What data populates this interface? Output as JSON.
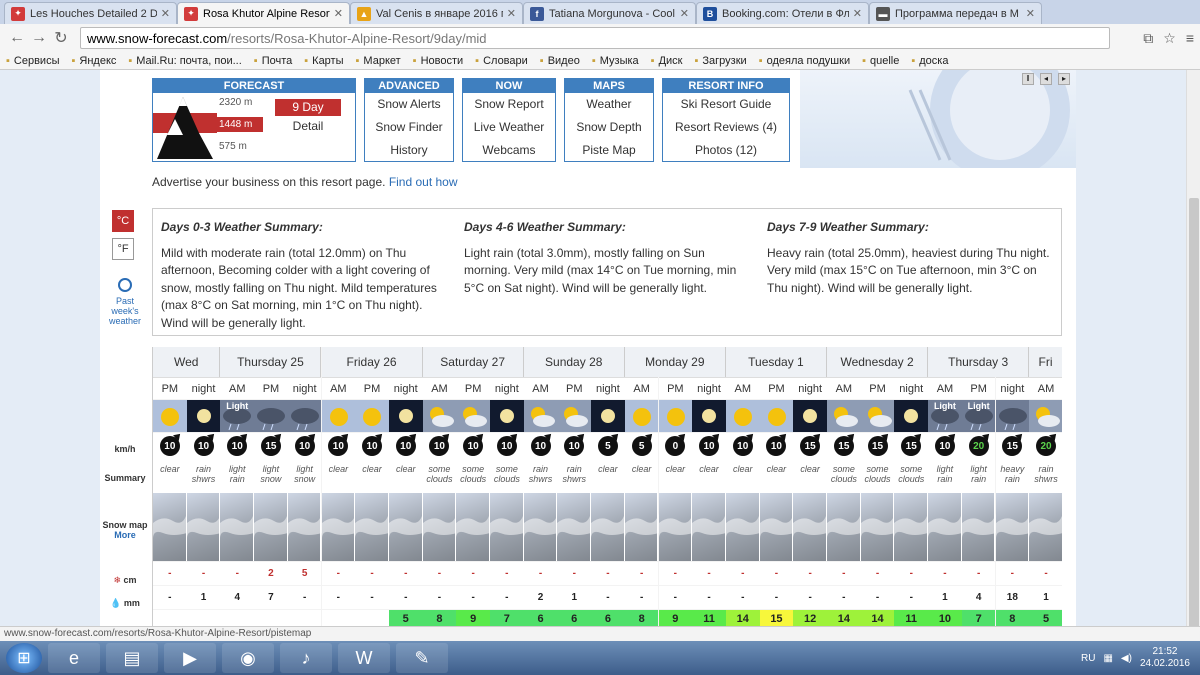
{
  "tabs": [
    {
      "title": "Les Houches Detailed 2 Da",
      "color": "#d23b3b",
      "glyph": "✦"
    },
    {
      "title": "Rosa Khutor Alpine Resort",
      "color": "#d23b3b",
      "glyph": "✦",
      "active": true
    },
    {
      "title": "Val Cenis в январе 2016 г",
      "color": "#e8a317",
      "glyph": "▲"
    },
    {
      "title": "Tatiana Morgunova - Cool",
      "color": "#3b5998",
      "glyph": "f"
    },
    {
      "title": "Booking.com: Отели в Фл",
      "color": "#1f4f9c",
      "glyph": "B"
    },
    {
      "title": "Программа передач в М",
      "color": "#555555",
      "glyph": "▬"
    }
  ],
  "url": {
    "host": "www.snow-forecast.com",
    "path": "/resorts/Rosa-Khutor-Alpine-Resort/9day/mid"
  },
  "bookmarks": [
    "Сервисы",
    "Яндекс",
    "Mail.Ru: почта, пои...",
    "Почта",
    "Карты",
    "Маркет",
    "Новости",
    "Словари",
    "Видео",
    "Музыка",
    "Диск",
    "Загрузки",
    "одеяла подушки",
    "quelle",
    "доска"
  ],
  "forecast_box": {
    "title": "FORECAST",
    "elev_top": "2320 m",
    "elev_mid": "1448 m",
    "elev_low": "575 m",
    "btn": "9 Day",
    "detail": "Detail"
  },
  "menus": [
    {
      "title": "ADVANCED",
      "items": [
        "Snow Alerts",
        "Snow Finder",
        "History"
      ]
    },
    {
      "title": "NOW",
      "items": [
        "Snow Report",
        "Live Weather",
        "Webcams"
      ]
    },
    {
      "title": "MAPS",
      "items": [
        "Weather",
        "Snow Depth",
        "Piste Map"
      ]
    },
    {
      "title": "RESORT INFO",
      "items": [
        "Ski Resort Guide",
        "Resort Reviews (4)",
        "Photos (12)"
      ]
    }
  ],
  "advert": {
    "text": "Advertise your business on this resort page.",
    "link": "Find out how"
  },
  "units": {
    "c": "°C",
    "f": "°F"
  },
  "past_week": "Past week's weather",
  "summaries": [
    {
      "heading": "Days 0-3 Weather Summary:",
      "text": "Mild with moderate rain (total 12.0mm) on Thu afternoon, Becoming colder with a light covering of snow, mostly falling on Thu night. Mild temperatures (max 8°C on Sat morning, min 1°C on Thu night). Wind will be generally light."
    },
    {
      "heading": "Days 4-6 Weather Summary:",
      "text": "Light rain (total 3.0mm), mostly falling on Sun morning. Very mild (max 14°C on Tue morning, min 5°C on Sat night). Wind will be generally light."
    },
    {
      "heading": "Days 7-9 Weather Summary:",
      "text": "Heavy rain (total 25.0mm), heaviest during Thu night. Very mild (max 15°C on Tue afternoon, min 3°C on Thu night). Wind will be generally light."
    }
  ],
  "row_labels": {
    "wind": "km/h",
    "summary": "Summary",
    "snowmap": "Snow map",
    "more": "More",
    "snow": "cm",
    "rain": "mm"
  },
  "days": [
    {
      "name": "Wed",
      "cols": 2
    },
    {
      "name": "Thursday 25",
      "cols": 3
    },
    {
      "name": "Friday 26",
      "cols": 3
    },
    {
      "name": "Saturday 27",
      "cols": 3
    },
    {
      "name": "Sunday 28",
      "cols": 3
    },
    {
      "name": "Monday 29",
      "cols": 3
    },
    {
      "name": "Tuesday 1",
      "cols": 3
    },
    {
      "name": "Wednesday 2",
      "cols": 3
    },
    {
      "name": "Thursday 3",
      "cols": 3
    },
    {
      "name": "Fri",
      "cols": 1
    }
  ],
  "periods": [
    {
      "p": "PM",
      "wx": "sun",
      "lbl": "",
      "wind": "10",
      "sum": "clear",
      "snow": "-",
      "rain": "-",
      "temp": ""
    },
    {
      "p": "night",
      "wx": "moon",
      "lbl": "",
      "wind": "10",
      "sum": "rain shwrs",
      "snow": "-",
      "rain": "1",
      "temp": ""
    },
    {
      "p": "AM",
      "wx": "rain",
      "lbl": "Light",
      "wind": "10",
      "sum": "light rain",
      "snow": "-",
      "rain": "4",
      "temp": ""
    },
    {
      "p": "PM",
      "wx": "rain",
      "lbl": "",
      "wind": "15",
      "sum": "light snow",
      "snow": "2",
      "rain": "7",
      "temp": ""
    },
    {
      "p": "night",
      "wx": "rain",
      "lbl": "",
      "wind": "10",
      "sum": "light snow",
      "snow": "5",
      "rain": "-",
      "temp": ""
    },
    {
      "p": "AM",
      "wx": "sun",
      "lbl": "",
      "wind": "10",
      "sum": "clear",
      "snow": "-",
      "rain": "-",
      "temp": ""
    },
    {
      "p": "PM",
      "wx": "sun",
      "lbl": "",
      "wind": "10",
      "sum": "clear",
      "snow": "-",
      "rain": "-",
      "temp": ""
    },
    {
      "p": "night",
      "wx": "moon",
      "lbl": "",
      "wind": "10",
      "sum": "clear",
      "snow": "-",
      "rain": "-",
      "temp": "5"
    },
    {
      "p": "AM",
      "wx": "cloud",
      "lbl": "",
      "wind": "10",
      "sum": "some clouds",
      "snow": "-",
      "rain": "-",
      "temp": "8"
    },
    {
      "p": "PM",
      "wx": "cloud",
      "lbl": "",
      "wind": "10",
      "sum": "some clouds",
      "snow": "-",
      "rain": "-",
      "temp": "9"
    },
    {
      "p": "night",
      "wx": "moon",
      "lbl": "",
      "wind": "10",
      "sum": "some clouds",
      "snow": "-",
      "rain": "-",
      "temp": "7"
    },
    {
      "p": "AM",
      "wx": "cloud",
      "lbl": "",
      "wind": "10",
      "sum": "rain shwrs",
      "snow": "-",
      "rain": "2",
      "temp": "6"
    },
    {
      "p": "PM",
      "wx": "cloud",
      "lbl": "",
      "wind": "10",
      "sum": "rain shwrs",
      "snow": "-",
      "rain": "1",
      "temp": "6"
    },
    {
      "p": "night",
      "wx": "moon",
      "lbl": "",
      "wind": "5",
      "sum": "clear",
      "snow": "-",
      "rain": "-",
      "temp": "6"
    },
    {
      "p": "AM",
      "wx": "sun",
      "lbl": "",
      "wind": "5",
      "sum": "clear",
      "snow": "-",
      "rain": "-",
      "temp": "8"
    },
    {
      "p": "PM",
      "wx": "sun",
      "lbl": "",
      "wind": "0",
      "sum": "clear",
      "snow": "-",
      "rain": "-",
      "temp": "9"
    },
    {
      "p": "night",
      "wx": "moon",
      "lbl": "",
      "wind": "10",
      "sum": "clear",
      "snow": "-",
      "rain": "-",
      "temp": "11"
    },
    {
      "p": "AM",
      "wx": "sun",
      "lbl": "",
      "wind": "10",
      "sum": "clear",
      "snow": "-",
      "rain": "-",
      "temp": "14"
    },
    {
      "p": "PM",
      "wx": "sun",
      "lbl": "",
      "wind": "10",
      "sum": "clear",
      "snow": "-",
      "rain": "-",
      "temp": "15"
    },
    {
      "p": "night",
      "wx": "moon",
      "lbl": "",
      "wind": "15",
      "sum": "clear",
      "snow": "-",
      "rain": "-",
      "temp": "12"
    },
    {
      "p": "AM",
      "wx": "cloud",
      "lbl": "",
      "wind": "15",
      "sum": "some clouds",
      "snow": "-",
      "rain": "-",
      "temp": "14"
    },
    {
      "p": "PM",
      "wx": "cloud",
      "lbl": "",
      "wind": "15",
      "sum": "some clouds",
      "snow": "-",
      "rain": "-",
      "temp": "14"
    },
    {
      "p": "night",
      "wx": "moon",
      "lbl": "",
      "wind": "15",
      "sum": "some clouds",
      "snow": "-",
      "rain": "-",
      "temp": "11"
    },
    {
      "p": "AM",
      "wx": "rain",
      "lbl": "Light",
      "wind": "10",
      "sum": "light rain",
      "snow": "-",
      "rain": "1",
      "temp": "10"
    },
    {
      "p": "PM",
      "wx": "rain",
      "lbl": "Light",
      "wind": "20",
      "sum": "light rain",
      "snow": "-",
      "rain": "4",
      "temp": "7"
    },
    {
      "p": "night",
      "wx": "rain",
      "lbl": "",
      "wind": "15",
      "sum": "heavy rain",
      "snow": "-",
      "rain": "18",
      "temp": "8"
    },
    {
      "p": "AM",
      "wx": "cloud",
      "lbl": "",
      "wind": "20",
      "sum": "rain shwrs",
      "snow": "-",
      "rain": "1",
      "temp": "5"
    }
  ],
  "status_url": "www.snow-forecast.com/resorts/Rosa-Khutor-Alpine-Resort/pistemap",
  "taskbar": {
    "lang": "RU",
    "time": "21:52",
    "date": "24.02.2016"
  }
}
